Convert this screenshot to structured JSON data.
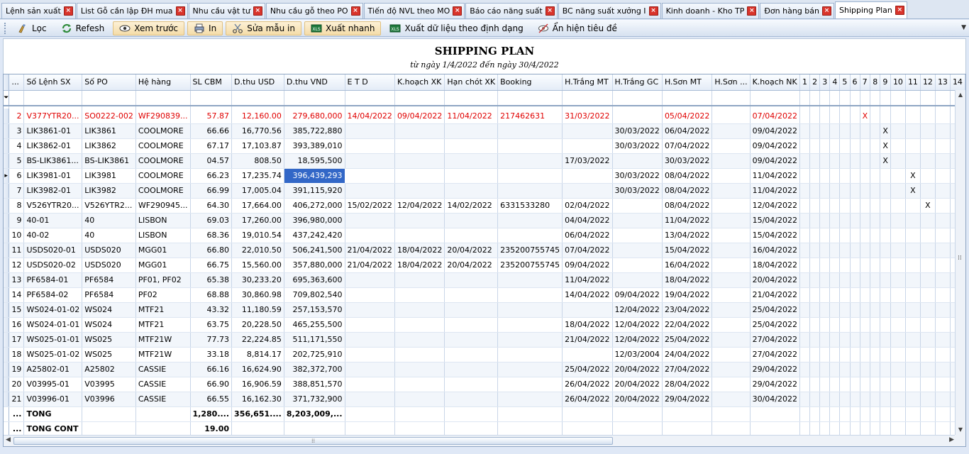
{
  "tabs": [
    {
      "label": "Lệnh sản xuất",
      "active": false
    },
    {
      "label": "List Gỗ cần lập ĐH mua",
      "active": false
    },
    {
      "label": "Nhu cầu vật tư",
      "active": false
    },
    {
      "label": "Nhu cầu gỗ theo PO",
      "active": false
    },
    {
      "label": "Tiến độ NVL theo MO",
      "active": false
    },
    {
      "label": "Báo cáo năng suất",
      "active": false
    },
    {
      "label": "BC năng suất xưởng I",
      "active": false
    },
    {
      "label": "Kinh doanh - Kho TP",
      "active": false
    },
    {
      "label": "Đơn hàng bán",
      "active": false
    },
    {
      "label": "Shipping Plan",
      "active": true
    }
  ],
  "toolbar": {
    "filter": "Lọc",
    "refresh": "Refesh",
    "preview": "Xem trước",
    "print": "In",
    "edit_template": "Sửa mẫu in",
    "quick_export": "Xuất nhanh",
    "export_formatted": "Xuất dữ liệu theo định dạng",
    "toggle_title": "Ẩn hiện tiêu đề",
    "filter_icon": "broom-icon",
    "refresh_icon": "refresh-icon",
    "preview_icon": "eye-icon",
    "print_icon": "printer-icon",
    "edit_icon": "scissors-icon",
    "export_icon": "excel-icon"
  },
  "report": {
    "title": "SHIPPING PLAN",
    "subtitle": "từ ngày 1/4/2022  đến ngày 30/4/2022"
  },
  "grid": {
    "columns": [
      "...",
      "Số Lệnh SX",
      "Số PO",
      "Hệ hàng",
      "SL CBM",
      "D.thu USD",
      "D.thu VND",
      "E T D",
      "K.hoạch XK",
      "Hạn chót XK",
      "Booking",
      "H.Trắng MT",
      "H.Trắng GC",
      "H.Sơn MT",
      "H.Sơn ...",
      "K.hoạch NK",
      "1",
      "2",
      "3",
      "4",
      "5",
      "6",
      "7",
      "8",
      "9",
      "10",
      "11",
      "12",
      "13",
      "14"
    ],
    "rows": [
      {
        "n": "2",
        "lenh": "V377YTR20...",
        "po": "SO0222-002",
        "he": "WF290839...",
        "cbm": "57.87",
        "usd": "12,160.00",
        "vnd": "279,680,000",
        "etd": "14/04/2022",
        "khxk": "09/04/2022",
        "hcxk": "11/04/2022",
        "booking": "217462631",
        "htmt": "31/03/2022",
        "htgc": "",
        "hsmt": "05/04/2022",
        "hs": "",
        "khnk": "07/04/2022",
        "mark_col": 7,
        "red": true
      },
      {
        "n": "3",
        "lenh": "LIK3861-01",
        "po": "LIK3861",
        "he": "COOLMORE",
        "cbm": "66.66",
        "usd": "16,770.56",
        "vnd": "385,722,880",
        "etd": "",
        "khxk": "",
        "hcxk": "",
        "booking": "",
        "htmt": "",
        "htgc": "30/03/2022",
        "hsmt": "06/04/2022",
        "hs": "",
        "khnk": "09/04/2022",
        "mark_col": 9
      },
      {
        "n": "4",
        "lenh": "LIK3862-01",
        "po": "LIK3862",
        "he": "COOLMORE",
        "cbm": "67.17",
        "usd": "17,103.87",
        "vnd": "393,389,010",
        "etd": "",
        "khxk": "",
        "hcxk": "",
        "booking": "",
        "htmt": "",
        "htgc": "30/03/2022",
        "hsmt": "07/04/2022",
        "hs": "",
        "khnk": "09/04/2022",
        "mark_col": 9
      },
      {
        "n": "5",
        "lenh": "BS-LIK3861...",
        "po": "BS-LIK3861",
        "he": "COOLMORE",
        "cbm": "04.57",
        "usd": "808.50",
        "vnd": "18,595,500",
        "etd": "",
        "khxk": "",
        "hcxk": "",
        "booking": "",
        "htmt": "17/03/2022",
        "htgc": "",
        "hsmt": "30/03/2022",
        "hs": "",
        "khnk": "09/04/2022",
        "mark_col": 9
      },
      {
        "n": "6",
        "lenh": "LIK3981-01",
        "po": "LIK3981",
        "he": "COOLMORE",
        "cbm": "66.23",
        "usd": "17,235.74",
        "vnd": "396,439,293",
        "etd": "",
        "khxk": "",
        "hcxk": "",
        "booking": "",
        "htmt": "",
        "htgc": "30/03/2022",
        "hsmt": "08/04/2022",
        "hs": "",
        "khnk": "11/04/2022",
        "mark_col": 11,
        "current": true
      },
      {
        "n": "7",
        "lenh": "LIK3982-01",
        "po": "LIK3982",
        "he": "COOLMORE",
        "cbm": "66.99",
        "usd": "17,005.04",
        "vnd": "391,115,920",
        "etd": "",
        "khxk": "",
        "hcxk": "",
        "booking": "",
        "htmt": "",
        "htgc": "30/03/2022",
        "hsmt": "08/04/2022",
        "hs": "",
        "khnk": "11/04/2022",
        "mark_col": 11
      },
      {
        "n": "8",
        "lenh": "V526YTR20...",
        "po": "V526YTR2...",
        "he": "WF290945...",
        "cbm": "64.30",
        "usd": "17,664.00",
        "vnd": "406,272,000",
        "etd": "15/02/2022",
        "khxk": "12/04/2022",
        "hcxk": "14/02/2022",
        "booking": "6331533280",
        "htmt": "02/04/2022",
        "htgc": "",
        "hsmt": "08/04/2022",
        "hs": "",
        "khnk": "12/04/2022",
        "mark_col": 12
      },
      {
        "n": "9",
        "lenh": "40-01",
        "po": "40",
        "he": "LISBON",
        "cbm": "69.03",
        "usd": "17,260.00",
        "vnd": "396,980,000",
        "etd": "",
        "khxk": "",
        "hcxk": "",
        "booking": "",
        "htmt": "04/04/2022",
        "htgc": "",
        "hsmt": "11/04/2022",
        "hs": "",
        "khnk": "15/04/2022"
      },
      {
        "n": "10",
        "lenh": "40-02",
        "po": "40",
        "he": "LISBON",
        "cbm": "68.36",
        "usd": "19,010.54",
        "vnd": "437,242,420",
        "etd": "",
        "khxk": "",
        "hcxk": "",
        "booking": "",
        "htmt": "06/04/2022",
        "htgc": "",
        "hsmt": "13/04/2022",
        "hs": "",
        "khnk": "15/04/2022"
      },
      {
        "n": "11",
        "lenh": "USDS020-01",
        "po": "USDS020",
        "he": "MGG01",
        "cbm": "66.80",
        "usd": "22,010.50",
        "vnd": "506,241,500",
        "etd": "21/04/2022",
        "khxk": "18/04/2022",
        "hcxk": "20/04/2022",
        "booking": "235200755745",
        "htmt": "07/04/2022",
        "htgc": "",
        "hsmt": "15/04/2022",
        "hs": "",
        "khnk": "16/04/2022"
      },
      {
        "n": "12",
        "lenh": "USDS020-02",
        "po": "USDS020",
        "he": "MGG01",
        "cbm": "66.75",
        "usd": "15,560.00",
        "vnd": "357,880,000",
        "etd": "21/04/2022",
        "khxk": "18/04/2022",
        "hcxk": "20/04/2022",
        "booking": "235200755745",
        "htmt": "09/04/2022",
        "htgc": "",
        "hsmt": "16/04/2022",
        "hs": "",
        "khnk": "18/04/2022"
      },
      {
        "n": "13",
        "lenh": "PF6584-01",
        "po": "PF6584",
        "he": "PF01, PF02",
        "cbm": "65.38",
        "usd": "30,233.20",
        "vnd": "695,363,600",
        "etd": "",
        "khxk": "",
        "hcxk": "",
        "booking": "",
        "htmt": "11/04/2022",
        "htgc": "",
        "hsmt": "18/04/2022",
        "hs": "",
        "khnk": "20/04/2022"
      },
      {
        "n": "14",
        "lenh": "PF6584-02",
        "po": "PF6584",
        "he": "PF02",
        "cbm": "68.88",
        "usd": "30,860.98",
        "vnd": "709,802,540",
        "etd": "",
        "khxk": "",
        "hcxk": "",
        "booking": "",
        "htmt": "14/04/2022",
        "htgc": "09/04/2022",
        "hsmt": "19/04/2022",
        "hs": "",
        "khnk": "21/04/2022"
      },
      {
        "n": "15",
        "lenh": "WS024-01-02",
        "po": "WS024",
        "he": "MTF21",
        "cbm": "43.32",
        "usd": "11,180.59",
        "vnd": "257,153,570",
        "etd": "",
        "khxk": "",
        "hcxk": "",
        "booking": "",
        "htmt": "",
        "htgc": "12/04/2022",
        "hsmt": "23/04/2022",
        "hs": "",
        "khnk": "25/04/2022"
      },
      {
        "n": "16",
        "lenh": "WS024-01-01",
        "po": "WS024",
        "he": "MTF21",
        "cbm": "63.75",
        "usd": "20,228.50",
        "vnd": "465,255,500",
        "etd": "",
        "khxk": "",
        "hcxk": "",
        "booking": "",
        "htmt": "18/04/2022",
        "htgc": "12/04/2022",
        "hsmt": "22/04/2022",
        "hs": "",
        "khnk": "25/04/2022"
      },
      {
        "n": "17",
        "lenh": "WS025-01-01",
        "po": "WS025",
        "he": "MTF21W",
        "cbm": "77.73",
        "usd": "22,224.85",
        "vnd": "511,171,550",
        "etd": "",
        "khxk": "",
        "hcxk": "",
        "booking": "",
        "htmt": "21/04/2022",
        "htgc": "12/04/2022",
        "hsmt": "25/04/2022",
        "hs": "",
        "khnk": "27/04/2022"
      },
      {
        "n": "18",
        "lenh": "WS025-01-02",
        "po": "WS025",
        "he": "MTF21W",
        "cbm": "33.18",
        "usd": "8,814.17",
        "vnd": "202,725,910",
        "etd": "",
        "khxk": "",
        "hcxk": "",
        "booking": "",
        "htmt": "",
        "htgc": "12/03/2004",
        "hsmt": "24/04/2022",
        "hs": "",
        "khnk": "27/04/2022"
      },
      {
        "n": "19",
        "lenh": "A25802-01",
        "po": "A25802",
        "he": "CASSIE",
        "cbm": "66.16",
        "usd": "16,624.90",
        "vnd": "382,372,700",
        "etd": "",
        "khxk": "",
        "hcxk": "",
        "booking": "",
        "htmt": "25/04/2022",
        "htgc": "20/04/2022",
        "hsmt": "27/04/2022",
        "hs": "",
        "khnk": "29/04/2022"
      },
      {
        "n": "20",
        "lenh": "V03995-01",
        "po": "V03995",
        "he": "CASSIE",
        "cbm": "66.90",
        "usd": "16,906.59",
        "vnd": "388,851,570",
        "etd": "",
        "khxk": "",
        "hcxk": "",
        "booking": "",
        "htmt": "26/04/2022",
        "htgc": "20/04/2022",
        "hsmt": "28/04/2022",
        "hs": "",
        "khnk": "29/04/2022"
      },
      {
        "n": "21",
        "lenh": "V03996-01",
        "po": "V03996",
        "he": "CASSIE",
        "cbm": "66.55",
        "usd": "16,162.30",
        "vnd": "371,732,900",
        "etd": "",
        "khxk": "",
        "hcxk": "",
        "booking": "",
        "htmt": "26/04/2022",
        "htgc": "20/04/2022",
        "hsmt": "29/04/2022",
        "hs": "",
        "khnk": "30/04/2022"
      }
    ],
    "mark_symbol": "X",
    "totals": {
      "n": "...",
      "label": "TONG",
      "cbm": "1,280....",
      "usd": "356,651....",
      "vnd": "8,203,009,..."
    },
    "totals_cont": {
      "n": "...",
      "label": "TONG CONT",
      "cbm": "19.00"
    }
  }
}
